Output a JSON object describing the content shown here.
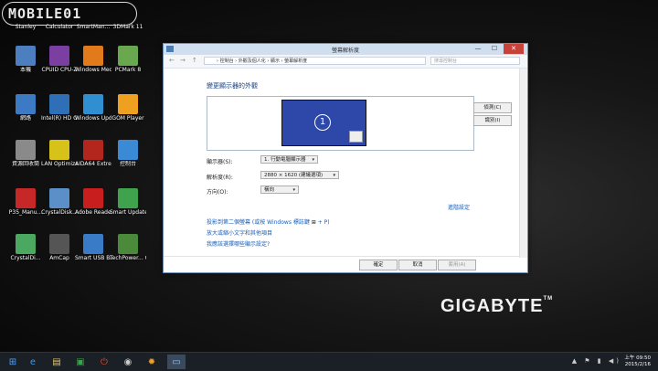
{
  "watermark": "MOBILE01",
  "brand": "GIGABYTE",
  "brand_tm": "TM",
  "desktop_icons": [
    {
      "label": "Stanley",
      "icon": "user-folder-icon",
      "color": "#c79a4a"
    },
    {
      "label": "Calculator",
      "icon": "calculator-icon",
      "color": "#3a3a3a"
    },
    {
      "label": "SmartMan...",
      "icon": "smart-manager-icon",
      "color": "#2a6cb5"
    },
    {
      "label": "3DMark 11",
      "icon": "3dmark-icon",
      "color": "#444444"
    },
    {
      "label": "本機",
      "icon": "computer-icon",
      "color": "#4b7fbf"
    },
    {
      "label": "CPUID CPU-Z",
      "icon": "cpuz-icon",
      "color": "#7a3fa0"
    },
    {
      "label": "Windows Media Player",
      "icon": "media-player-icon",
      "color": "#e07a1a"
    },
    {
      "label": "PCMark 8",
      "icon": "pcmark-icon",
      "color": "#6aa84f"
    },
    {
      "label": "網路",
      "icon": "network-icon",
      "color": "#3d7ac4"
    },
    {
      "label": "Intel(R) HD Graphics ...",
      "icon": "intel-graphics-icon",
      "color": "#2f6fb8"
    },
    {
      "label": "Windows Update",
      "icon": "windows-update-icon",
      "color": "#2f8fd0"
    },
    {
      "label": "GOM Player",
      "icon": "gom-player-icon",
      "color": "#f0a020"
    },
    {
      "label": "資源回收筒",
      "icon": "recycle-bin-icon",
      "color": "#8a8a8a"
    },
    {
      "label": "LAN Optimizer",
      "icon": "lan-optimizer-icon",
      "color": "#d7c21a"
    },
    {
      "label": "AIDA64 Extreme",
      "icon": "aida64-icon",
      "color": "#b3261e"
    },
    {
      "label": "控制台",
      "icon": "control-panel-icon",
      "color": "#3a8ad6"
    },
    {
      "label": "P35_Manu...",
      "icon": "pdf-icon",
      "color": "#c62828"
    },
    {
      "label": "CrystalDisk...",
      "icon": "crystaldisk-icon",
      "color": "#5a8fc8"
    },
    {
      "label": "Adobe Reader XI",
      "icon": "adobe-reader-icon",
      "color": "#c81e1e"
    },
    {
      "label": "Smart Update",
      "icon": "smart-update-icon",
      "color": "#3fa34d"
    },
    {
      "label": "CrystalDi...",
      "icon": "crystaldisk-info-icon",
      "color": "#4aa860"
    },
    {
      "label": "AmCap",
      "icon": "amcap-icon",
      "color": "#555555"
    },
    {
      "label": "Smart USB Backup",
      "icon": "usb-backup-icon",
      "color": "#3a7bc8"
    },
    {
      "label": "TechPower... GPU-Z",
      "icon": "gpuz-icon",
      "color": "#4a8a3a"
    }
  ],
  "window": {
    "title": "螢幕解析度",
    "min": "—",
    "max": "☐",
    "close": "✕",
    "nav_back": "←",
    "nav_fwd": "→",
    "nav_up": "↑",
    "breadcrumb": "› 控制台 › 外觀及個人化 › 顯示 › 螢幕解析度",
    "search_placeholder": "搜尋控制台",
    "heading": "變更顯示器的外觀",
    "monitor_number": "1",
    "detect_button": "偵測(C)",
    "identify_button": "識別(I)",
    "display_label": "顯示器(S):",
    "display_value": "1. 行動電腦顯示器",
    "resolution_label": "解析度(R):",
    "resolution_value": "2880 × 1620 (建議選項)",
    "orientation_label": "方向(O):",
    "orientation_value": "橫向",
    "advanced_link": "進階設定",
    "project_link_prefix": "投影到第二個螢幕 (或按 Windows 標誌鍵",
    "project_link_suffix": "+ P)",
    "text_size_link": "放大或縮小文字和其他項目",
    "which_setting_link": "我應該選擇哪些顯示設定?",
    "ok_button": "確定",
    "cancel_button": "取消",
    "apply_button": "套用(A)"
  },
  "clock": {
    "time": "上午 09:50",
    "date": "2015/2/16"
  },
  "taskbar_items": [
    {
      "icon": "start-icon",
      "glyph": "⊞",
      "color": "#4aa3ff"
    },
    {
      "icon": "internet-explorer-icon",
      "glyph": "e",
      "color": "#3d9be9"
    },
    {
      "icon": "file-explorer-icon",
      "glyph": "▤",
      "color": "#e6c36a"
    },
    {
      "icon": "store-icon",
      "glyph": "▣",
      "color": "#3aa34a"
    },
    {
      "icon": "power-icon",
      "glyph": "⏻",
      "color": "#e04a2a"
    },
    {
      "icon": "media-icon",
      "glyph": "◉",
      "color": "#cccccc"
    },
    {
      "icon": "gom-icon",
      "glyph": "✹",
      "color": "#f0a020"
    },
    {
      "icon": "display-settings-icon",
      "glyph": "▭",
      "color": "#8fc3ff"
    }
  ]
}
